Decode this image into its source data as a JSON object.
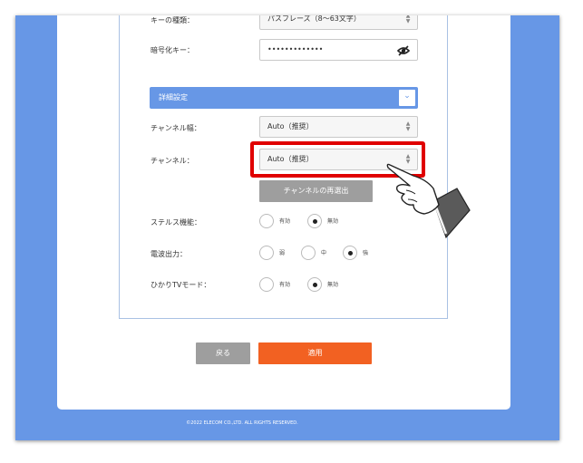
{
  "form": {
    "key_type_label": "キーの種類：",
    "key_type_value": "パスフレーズ（8〜63文字）",
    "encryption_key_label": "暗号化キー：",
    "encryption_key_value": "•••••••••••••",
    "detail_section_label": "詳細設定",
    "channel_width_label": "チャンネル幅：",
    "channel_width_value": "Auto（推奨）",
    "channel_label": "チャンネル：",
    "channel_value": "Auto（推奨）",
    "rescan_button": "チャンネルの再選出",
    "stealth_label": "ステルス機能：",
    "stealth_options": [
      {
        "label": "有効",
        "checked": false
      },
      {
        "label": "無効",
        "checked": true
      }
    ],
    "tx_power_label": "電波出力：",
    "tx_power_options": [
      {
        "label": "弱",
        "checked": false
      },
      {
        "label": "中",
        "checked": false
      },
      {
        "label": "強",
        "checked": true
      }
    ],
    "hikari_tv_label": "ひかりTVモード：",
    "hikari_tv_options": [
      {
        "label": "有効",
        "checked": false
      },
      {
        "label": "無効",
        "checked": true
      }
    ]
  },
  "buttons": {
    "back": "戻る",
    "apply": "適用"
  },
  "footer": {
    "copyright": "©2022 ELECOM CO.,LTD. ALL RIGHTS RESERVED."
  },
  "colors": {
    "accent_blue": "#6797e6",
    "apply_orange": "#f26122",
    "highlight_red": "#e00000",
    "button_gray": "#9e9e9e"
  }
}
